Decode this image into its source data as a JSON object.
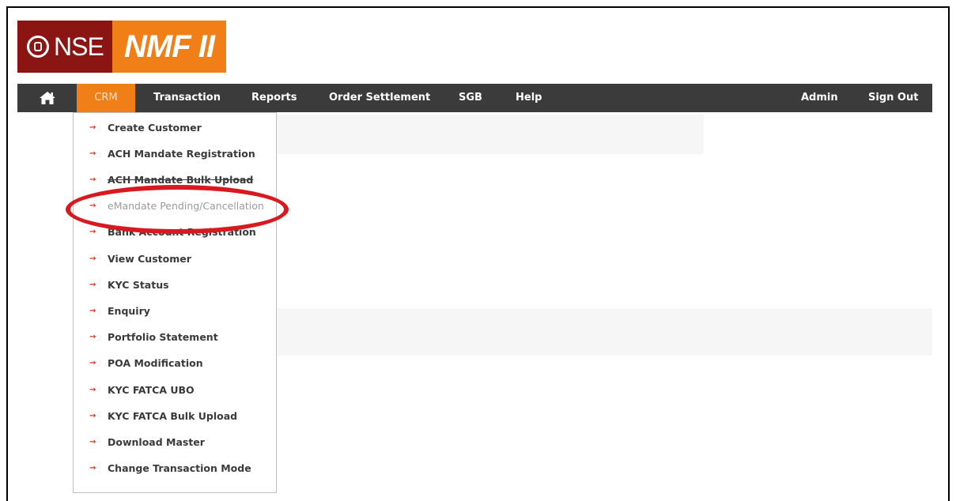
{
  "logo": {
    "left": "NSE",
    "right": "NMF II"
  },
  "nav": {
    "home_icon": "home-icon",
    "items": [
      "CRM",
      "Transaction",
      "Reports",
      "Order Settlement",
      "SGB",
      "Help"
    ],
    "right_items": [
      "Admin",
      "Sign Out"
    ],
    "active": "CRM"
  },
  "crm_menu": {
    "items": [
      "Create Customer",
      "ACH Mandate Registration",
      "ACH Mandate Bulk Upload",
      "eMandate Pending/Cancellation",
      "Bank Account Registration",
      "View Customer",
      "KYC Status",
      "Enquiry",
      "Portfolio Statement",
      "POA Modification",
      "KYC FATCA UBO",
      "KYC FATCA Bulk Upload",
      "Download Master",
      "Change Transaction Mode"
    ],
    "highlighted": "eMandate Pending/Cancellation",
    "arrow_glyph": "→"
  },
  "colors": {
    "brand_red": "#8b1512",
    "brand_orange": "#f07f17",
    "nav_bg": "#3b3b3b",
    "annotation_ring": "#d8191f"
  }
}
